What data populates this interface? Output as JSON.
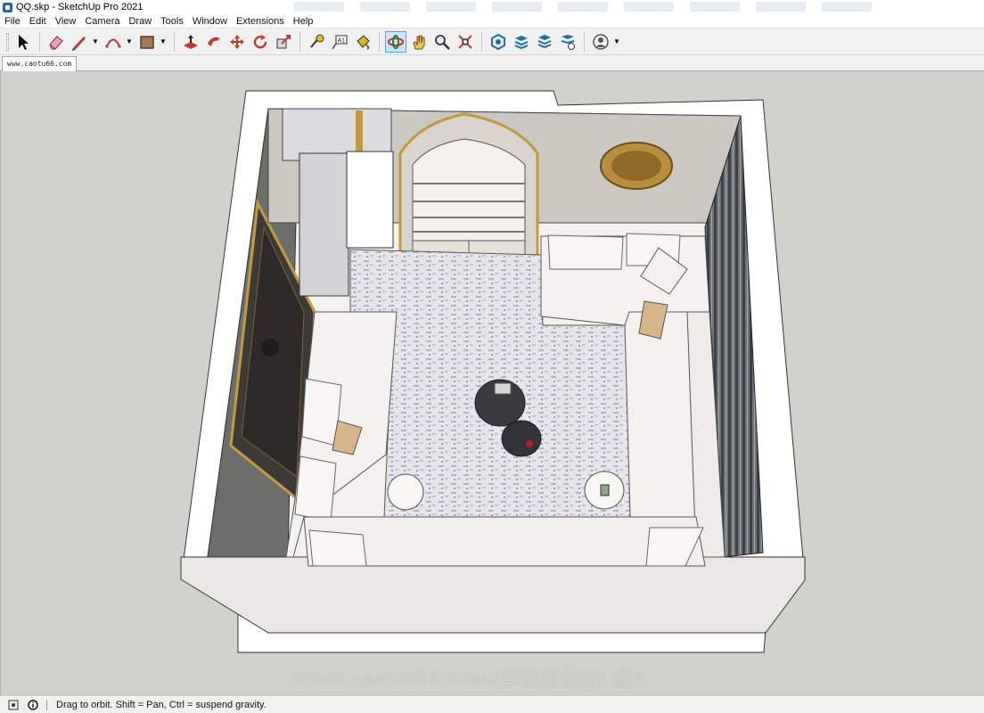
{
  "window": {
    "title": "QQ.skp - SketchUp Pro 2021"
  },
  "menu": [
    "File",
    "Edit",
    "View",
    "Camera",
    "Draw",
    "Tools",
    "Window",
    "Extensions",
    "Help"
  ],
  "toolbar": {
    "groups": [
      [
        {
          "icon": "select-arrow-icon"
        }
      ],
      [
        {
          "icon": "eraser-icon"
        },
        {
          "icon": "pencil-line-icon",
          "dropdown": true
        },
        {
          "icon": "arc-icon",
          "dropdown": true
        },
        {
          "icon": "rectangle-shape-icon",
          "dropdown": true
        }
      ],
      [
        {
          "icon": "push-pull-icon"
        },
        {
          "icon": "follow-me-icon"
        },
        {
          "icon": "move-icon"
        },
        {
          "icon": "rotate-icon"
        },
        {
          "icon": "scale-icon"
        }
      ],
      [
        {
          "icon": "tape-measure-icon"
        },
        {
          "icon": "text-label-icon"
        },
        {
          "icon": "paint-bucket-icon"
        }
      ],
      [
        {
          "icon": "orbit-icon",
          "active": true
        },
        {
          "icon": "pan-hand-icon"
        },
        {
          "icon": "zoom-icon"
        },
        {
          "icon": "zoom-extents-icon"
        }
      ],
      [
        {
          "icon": "3d-warehouse-icon"
        },
        {
          "icon": "extension-warehouse-icon"
        },
        {
          "icon": "layout-send-icon"
        },
        {
          "icon": "extension-manager-icon"
        }
      ],
      [
        {
          "icon": "user-account-icon",
          "dropdown": true
        }
      ]
    ]
  },
  "scene_tabs": [
    "www.caotu66.com"
  ],
  "viewport": {
    "watermark": "www.caotu66.com(草图溜溜网) 图A",
    "background_color": "#d0d1cb"
  },
  "status": {
    "hint": "Drag to orbit. Shift = Pan, Ctrl = suspend gravity."
  }
}
